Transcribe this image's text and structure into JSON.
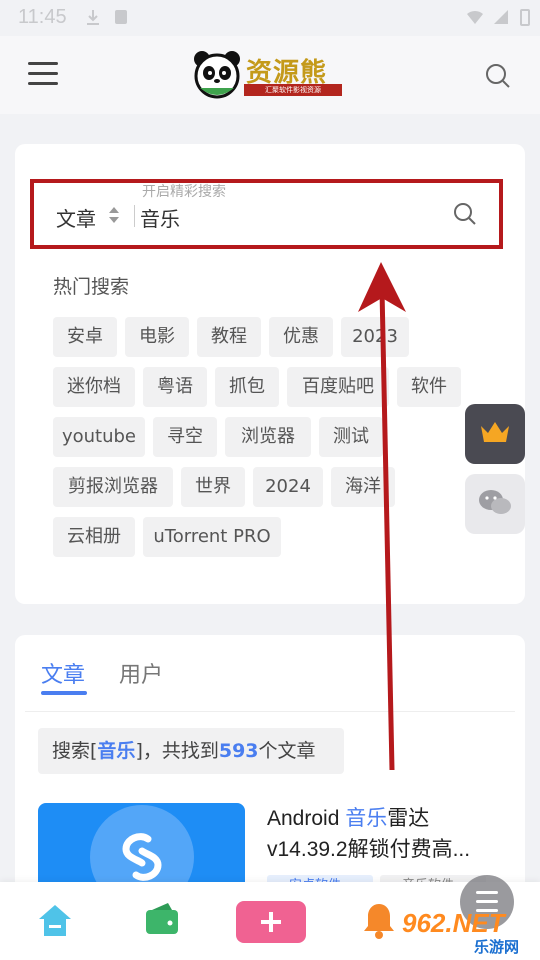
{
  "status_bar": {
    "time": "11:45"
  },
  "header": {
    "logo_text": "资源熊",
    "logo_subtitle": "汇聚软件影视资源"
  },
  "search": {
    "placeholder": "开启精彩搜索",
    "type_label": "文章",
    "query": "音乐"
  },
  "hot": {
    "title": "热门搜索",
    "tags": [
      "安卓",
      "电影",
      "教程",
      "优惠",
      "2023",
      "迷你档",
      "粤语",
      "抓包",
      "百度贴吧",
      "软件",
      "youtube",
      "寻空",
      "浏览器",
      "测试",
      "剪报浏览器",
      "世界",
      "2024",
      "海洋",
      "云相册",
      "uTorrent PRO"
    ]
  },
  "results": {
    "tabs": [
      "文章",
      "用户"
    ],
    "summary_prefix": "搜索[",
    "summary_keyword": "音乐",
    "summary_mid": "]，共找到",
    "summary_count": "593",
    "summary_suffix": "个文章",
    "article": {
      "title_prefix": "Android ",
      "title_keyword": "音乐",
      "title_suffix": "雷达",
      "title_line2": "v14.39.2解锁付费高...",
      "tag1": "安卓软件",
      "tag2": "音乐软件"
    }
  },
  "watermark": {
    "text": "962.NET",
    "sub": "乐游网"
  },
  "colors": {
    "accent": "#4a7ef0",
    "highlight_border": "#b5191c",
    "plus": "#f06292"
  }
}
